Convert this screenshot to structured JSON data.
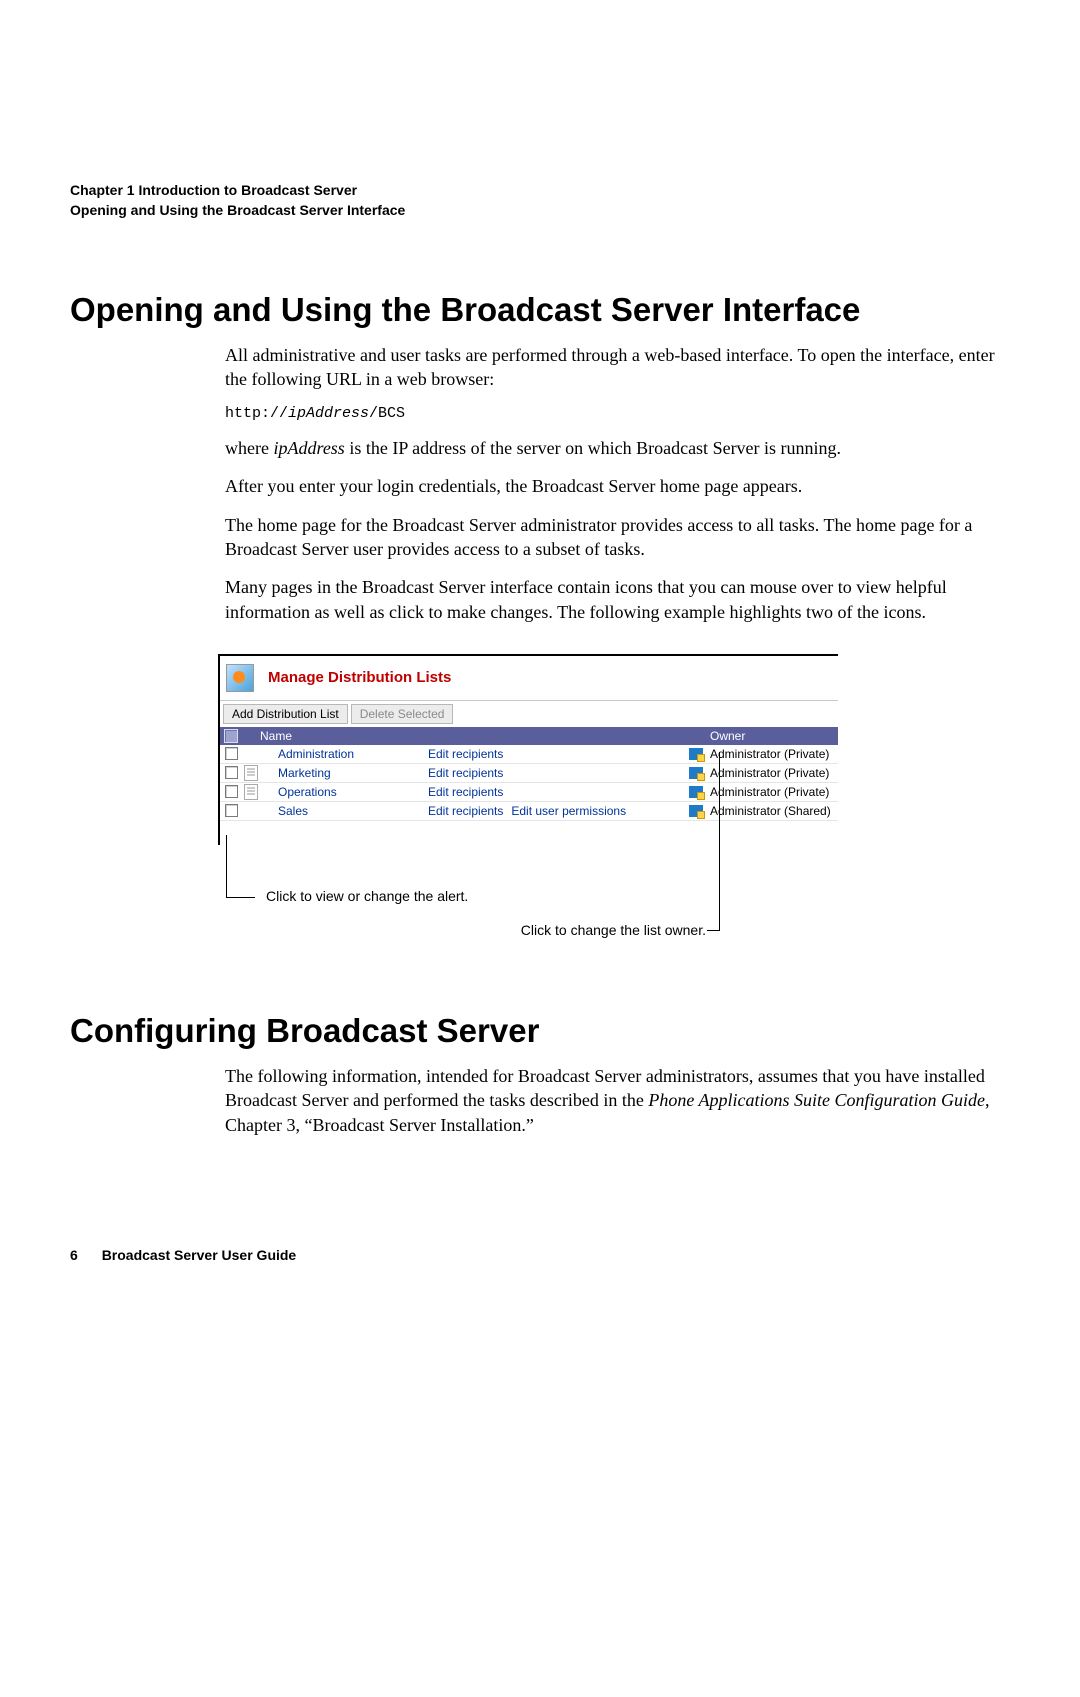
{
  "header": {
    "chapter": "Chapter 1     Introduction to Broadcast Server",
    "section": "Opening and Using the Broadcast Server Interface"
  },
  "section1": {
    "title": "Opening and Using the Broadcast Server Interface",
    "p1": "All administrative and user tasks are performed through a web-based interface. To open the interface, enter the following URL in a web browser:",
    "url_prefix": "http://",
    "url_var": "ipAddress",
    "url_suffix": "/BCS",
    "p2a": "where ",
    "p2b": "ipAddress",
    "p2c": " is the IP address of the server on which Broadcast Server is running.",
    "p3": "After you enter your login credentials, the Broadcast Server home page appears.",
    "p4": "The home page for the Broadcast Server administrator provides access to all tasks. The home page for a Broadcast Server user provides access to a subset of tasks.",
    "p5": "Many pages in the Broadcast Server interface contain icons that you can mouse over to view helpful information as well as click to make changes. The following example highlights two of the icons."
  },
  "screenshot": {
    "title": "Manage Distribution Lists",
    "btn_add": "Add Distribution List",
    "btn_delete": "Delete Selected",
    "col_name": "Name",
    "col_owner": "Owner",
    "edit_recipients": "Edit recipients",
    "edit_permissions": "Edit user permissions",
    "rows": [
      {
        "name": "Administration",
        "alert": false,
        "perm": false,
        "owner": "Administrator (Private)"
      },
      {
        "name": "Marketing",
        "alert": true,
        "perm": false,
        "owner": "Administrator (Private)"
      },
      {
        "name": "Operations",
        "alert": true,
        "perm": false,
        "owner": "Administrator (Private)"
      },
      {
        "name": "Sales",
        "alert": false,
        "perm": true,
        "owner": "Administrator (Shared)"
      }
    ],
    "callout1": "Click to view or change the alert.",
    "callout2": "Click to change the list owner."
  },
  "section2": {
    "title": "Configuring Broadcast Server",
    "p1a": "The following information, intended for Broadcast Server administrators, assumes that you have installed Broadcast Server and performed the tasks described in the ",
    "p1b": "Phone Applications Suite Configuration Guide",
    "p1c": ", Chapter 3, “Broadcast Server Installation.”"
  },
  "footer": {
    "page": "6",
    "title": "Broadcast Server User Guide"
  }
}
